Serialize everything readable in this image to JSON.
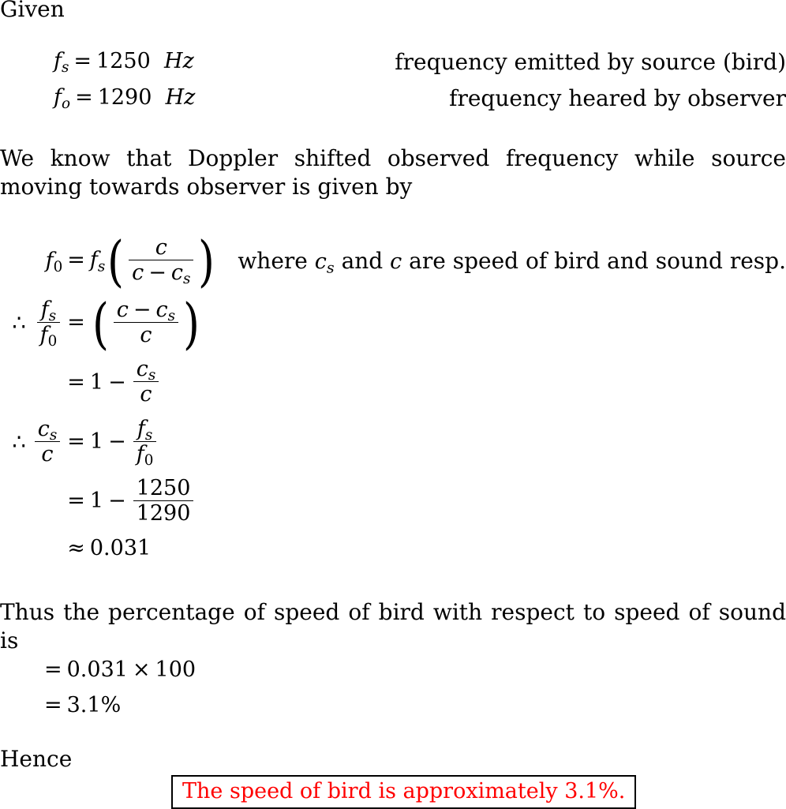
{
  "document": {
    "type": "physics-solution",
    "topic": "Doppler effect",
    "accent_color": "#ff0000",
    "text_color": "#000000",
    "background_color": "#ffffff"
  },
  "given": {
    "heading": "Given",
    "entries": [
      {
        "symbol": "f",
        "subscript": "s",
        "equals": "=",
        "value": "1250",
        "unit": "Hz",
        "description": "frequency emitted by source (bird)"
      },
      {
        "symbol": "f",
        "subscript": "o",
        "equals": "=",
        "value": "1290",
        "unit": "Hz",
        "description": "frequency heared by observer"
      }
    ]
  },
  "intro": {
    "paragraph": "We know that Doppler shifted observed frequency while source moving towards observer is given by"
  },
  "derivation": {
    "step1": {
      "therefore": "",
      "lhs_symbol": "f",
      "lhs_sub": "0",
      "equals": "=",
      "rhs_symbol": "f",
      "rhs_sub": "s",
      "frac_num": "c",
      "frac_den_left": "c",
      "frac_den_minus": "−",
      "frac_den_right_symbol": "c",
      "frac_den_right_sub": "s",
      "note_prefix": "where",
      "note_var1": "c",
      "note_var1_sub": "s",
      "note_mid": "and",
      "note_var2": "c",
      "note_suffix": "are speed of bird and sound resp."
    },
    "step2": {
      "therefore": "∴",
      "lhs_num_symbol": "f",
      "lhs_num_sub": "s",
      "lhs_den_symbol": "f",
      "lhs_den_sub": "0",
      "equals": "=",
      "rhs_num_left": "c",
      "rhs_num_minus": "−",
      "rhs_num_right_symbol": "c",
      "rhs_num_right_sub": "s",
      "rhs_den": "c"
    },
    "step3": {
      "therefore": "",
      "equals": "=",
      "one": "1",
      "minus": "−",
      "frac_num_symbol": "c",
      "frac_num_sub": "s",
      "frac_den": "c"
    },
    "step4": {
      "therefore": "∴",
      "lhs_num_symbol": "c",
      "lhs_num_sub": "s",
      "lhs_den": "c",
      "equals": "=",
      "one": "1",
      "minus": "−",
      "rhs_num_symbol": "f",
      "rhs_num_sub": "s",
      "rhs_den_symbol": "f",
      "rhs_den_sub": "0"
    },
    "step5": {
      "therefore": "",
      "equals": "=",
      "one": "1",
      "minus": "−",
      "frac_num": "1250",
      "frac_den": "1290"
    },
    "step6": {
      "therefore": "",
      "approx": "≈",
      "value": "0.031"
    }
  },
  "conclusion": {
    "paragraph": "Thus the percentage of speed of bird with respect to speed of sound is",
    "step1": {
      "equals": "=",
      "value": "0.031",
      "times": "×",
      "multiplier": "100"
    },
    "step2": {
      "equals": "=",
      "value": "3.1%"
    }
  },
  "hence": {
    "heading": "Hence",
    "answer": "The speed of bird is approximately 3.1%."
  }
}
